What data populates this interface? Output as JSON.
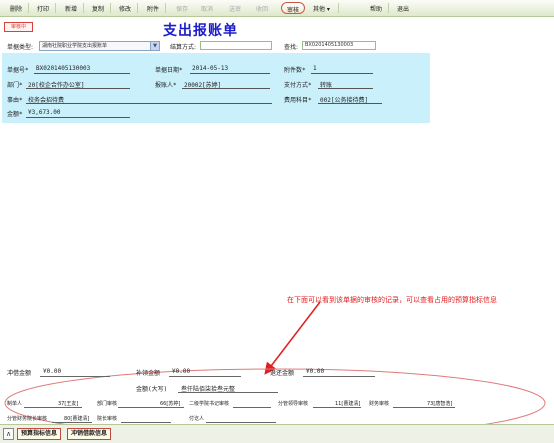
{
  "toolbar": {
    "items": [
      {
        "label": "删除",
        "enabled": true
      },
      {
        "label": "打印",
        "enabled": true
      },
      {
        "label": "新增",
        "enabled": true
      },
      {
        "label": "复制",
        "enabled": true
      },
      {
        "label": "修改",
        "enabled": true
      },
      {
        "label": "附件",
        "enabled": true
      },
      {
        "label": "保存",
        "enabled": false
      },
      {
        "label": "取消",
        "enabled": false
      },
      {
        "label": "送审",
        "enabled": false
      },
      {
        "label": "收回",
        "enabled": false
      },
      {
        "label": "审核",
        "enabled": true
      },
      {
        "label": "其他 ▾",
        "enabled": true
      },
      {
        "label": "帮助",
        "enabled": true
      },
      {
        "label": "退出",
        "enabled": true
      }
    ]
  },
  "status_badge": "审核中",
  "page_title": "支出报账单",
  "header": {
    "doc_type_label": "单据类型:",
    "doc_type_value": "湖南社院职业学院支出报账单",
    "settle_label": "结算方式:",
    "settle_value": "",
    "search_label": "查找:",
    "search_value": "BX0201405130003"
  },
  "form": {
    "doc_no_label": "单据号*",
    "doc_no_value": "BX0201405130003",
    "date_label": "单据日期*",
    "date_value": "2014-05-13",
    "attach_label": "附件数*",
    "attach_value": "1",
    "dept_label": "部门*",
    "dept_value": "20[校企合作办公室]",
    "claimant_label": "报账人*",
    "claimant_value": "20002[苏婷]",
    "paymethod_label": "支付方式*",
    "paymethod_value": "转账",
    "reason_label": "事由*",
    "reason_value": "校务会招待费",
    "expense_label": "费用科目*",
    "expense_value": "002[公务接待费]",
    "amount_label": "金额*",
    "amount_value": "¥3,673.00"
  },
  "annotation": "在下面可以看到该单据的审核的记录，可以查看占用的预算指标信息",
  "bottom": {
    "prepaid_label": "冲借金额",
    "prepaid_value": "¥0.00",
    "offset_label": "补领金额",
    "offset_value": "¥0.00",
    "refund_label": "退还金额",
    "refund_value": "¥0.00",
    "capital_label": "金额(大写)",
    "capital_value": "叁仟陆佰柒拾叁元整",
    "maker_label": "制单人",
    "maker_value": "37[王友]",
    "dept_audit_label": "部门审核",
    "dept_audit_value": "66[苏婷]",
    "secretary_label": "二级学院书记审核",
    "secretary_value": "",
    "leader_label": "分管领导审核",
    "leader_value": "11[曹建清]",
    "finance_label": "财务审核",
    "finance_value": "73[唐智浩]",
    "vp_label": "分管财务院长审核",
    "vp_value": "80[曹建清]",
    "president_label": "院长审核",
    "president_value": "",
    "payee_label": "付讫人",
    "payee_value": ""
  },
  "bottom_bar": {
    "collapse_label": "∧",
    "budget_btn": "预算指标信息",
    "loan_btn": "冲销借款信息"
  },
  "colors": {
    "title": "#1b1bc9",
    "panel_bg": "#c9f0fb",
    "annotation": "#e02020",
    "toolbar_bg": "#e6eed6"
  }
}
